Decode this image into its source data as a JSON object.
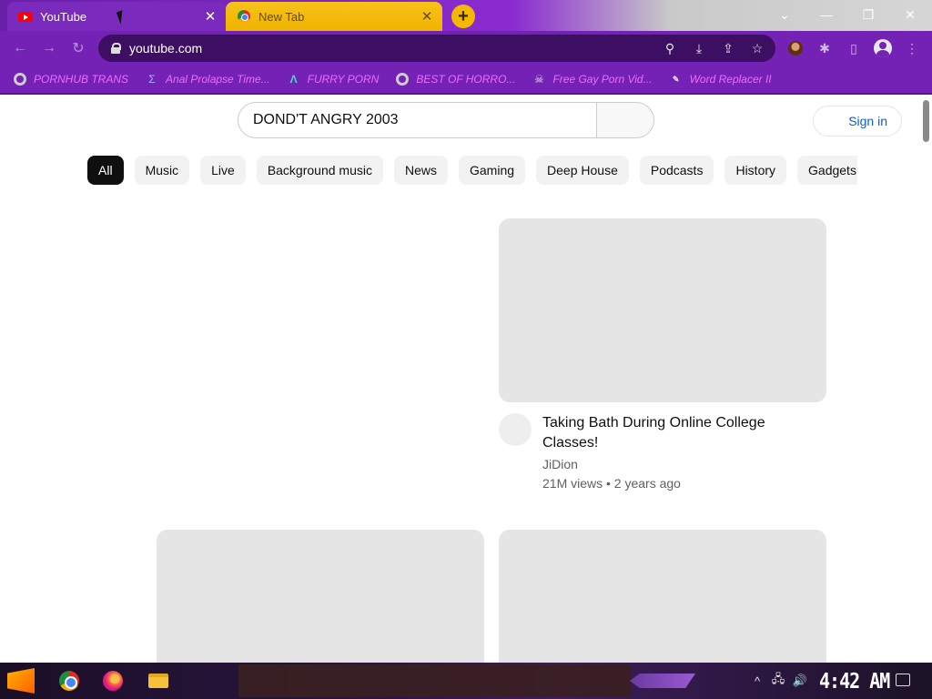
{
  "browser": {
    "tabs": [
      {
        "title": "YouTube",
        "favicon": "youtube-icon",
        "active": true
      },
      {
        "title": "New Tab",
        "favicon": "chrome-icon",
        "active": false
      }
    ],
    "new_tab_label": "+",
    "url": "youtube.com",
    "bookmarks": [
      {
        "label": "PORNHUB TRANS",
        "icon": "globe-icon"
      },
      {
        "label": "Anal Prolapse Time...",
        "icon": "sigma-icon"
      },
      {
        "label": "FURRY PORN",
        "icon": "lambda-icon"
      },
      {
        "label": "BEST OF HORRO...",
        "icon": "globe-icon"
      },
      {
        "label": "Free Gay Porn Vid...",
        "icon": "skull-icon"
      },
      {
        "label": "Word Replacer II",
        "icon": "wr-icon"
      }
    ],
    "accent": "#7422b5"
  },
  "youtube": {
    "search_value": "DOND'T ANGRY 2003",
    "signin_label": "Sign in",
    "chips": [
      "All",
      "Music",
      "Live",
      "Background music",
      "News",
      "Gaming",
      "Deep House",
      "Podcasts",
      "History",
      "Gadgets"
    ],
    "active_chip": "All",
    "video": {
      "title": "Taking Bath During Online College Classes!",
      "channel": "JiDion",
      "meta": "21M views • 2 years ago"
    }
  },
  "taskbar": {
    "clock": "4:42 AM"
  }
}
